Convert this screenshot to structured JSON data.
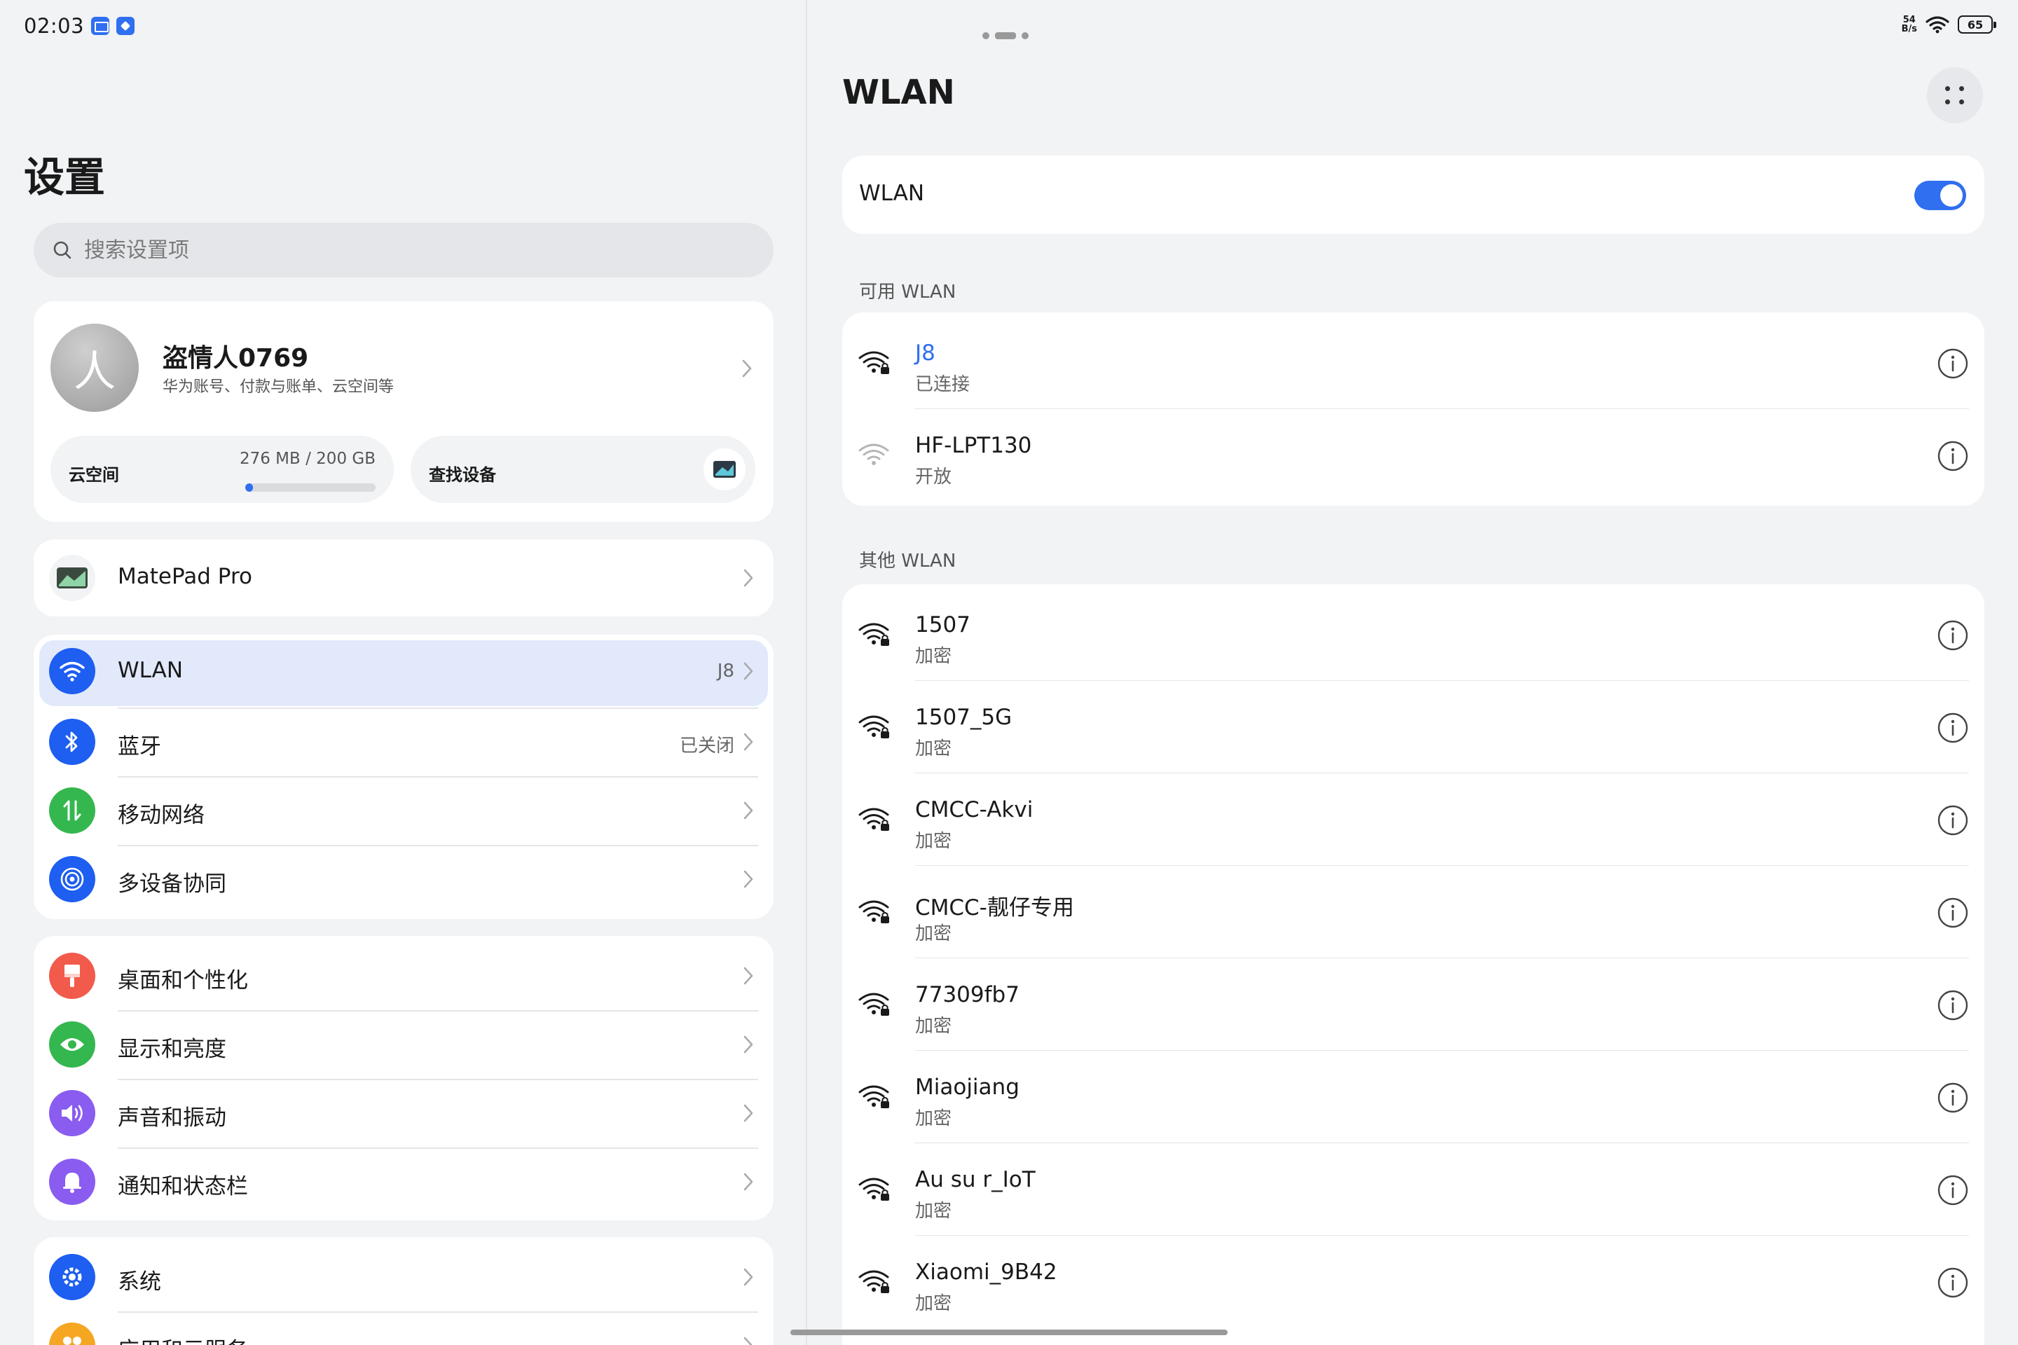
{
  "status_bar": {
    "time": "02:03",
    "net_speed_top": "54",
    "net_speed_bottom": "B/s",
    "battery": "65"
  },
  "settings": {
    "title": "设置",
    "search_placeholder": "搜索设置项",
    "account": {
      "avatar_char": "人",
      "name": "盗情人0769",
      "subtitle": "华为账号、付款与账单、云空间等",
      "cloud_label": "云空间",
      "cloud_usage": "276 MB / 200 GB",
      "cloud_fill_fraction": 0.05,
      "find_label": "查找设备"
    },
    "device": {
      "label": "MatePad Pro"
    },
    "group1": [
      {
        "label": "WLAN",
        "value": "J8",
        "icon": "wifi-icon",
        "color": "#1e5ef0"
      },
      {
        "label": "蓝牙",
        "value": "已关闭",
        "icon": "bluetooth-icon",
        "color": "#1e5ef0"
      },
      {
        "label": "移动网络",
        "value": "",
        "icon": "mobile-network-icon",
        "color": "#35b74f"
      },
      {
        "label": "多设备协同",
        "value": "",
        "icon": "multi-device-icon",
        "color": "#1e5ef0"
      }
    ],
    "group2": [
      {
        "label": "桌面和个性化",
        "icon": "brush-icon",
        "color": "#f25a4c"
      },
      {
        "label": "显示和亮度",
        "icon": "eye-icon",
        "color": "#35b74f"
      },
      {
        "label": "声音和振动",
        "icon": "speaker-icon",
        "color": "#8a5cf0"
      },
      {
        "label": "通知和状态栏",
        "icon": "bell-icon",
        "color": "#8a5cf0"
      }
    ],
    "group3": [
      {
        "label": "系统",
        "icon": "system-gear-icon",
        "color": "#1e5ef0"
      },
      {
        "label": "应用和元服务",
        "icon": "apps-icon",
        "color": "#f5a623"
      }
    ]
  },
  "wlan": {
    "title": "WLAN",
    "toggle_label": "WLAN",
    "toggle_on": true,
    "available_label": "可用 WLAN",
    "available": [
      {
        "ssid": "J8",
        "status": "已连接",
        "locked": true,
        "connected": true
      },
      {
        "ssid": "HF-LPT130",
        "status": "开放",
        "locked": false,
        "connected": false
      }
    ],
    "other_label": "其他 WLAN",
    "others": [
      {
        "ssid": "1507",
        "status": "加密"
      },
      {
        "ssid": "1507_5G",
        "status": "加密"
      },
      {
        "ssid": "CMCC-Akvi",
        "status": "加密"
      },
      {
        "ssid": "CMCC-靓仔专用",
        "status": "加密"
      },
      {
        "ssid": "77309fb7",
        "status": "加密"
      },
      {
        "ssid": "Miaojiang",
        "status": "加密"
      },
      {
        "ssid": "Au su r_IoT",
        "status": "加密"
      },
      {
        "ssid": "Xiaomi_9B42",
        "status": "加密"
      }
    ]
  }
}
